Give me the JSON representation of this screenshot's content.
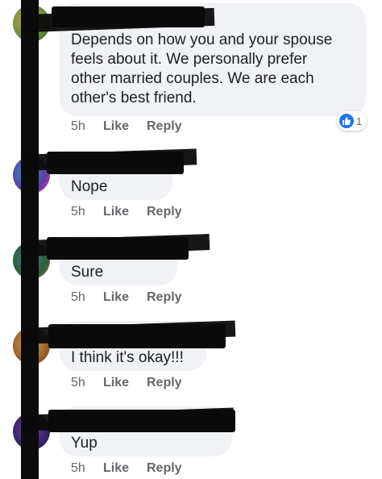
{
  "comments": [
    {
      "text_lines": [
        "Depends on how you and your spouse",
        "feels about it. We personally prefer",
        "other married couples. We are each",
        "other's best friend."
      ],
      "time": "5h",
      "like_label": "Like",
      "reply_label": "Reply",
      "reaction": {
        "icon": "thumbs-up-icon",
        "count": "1",
        "color": "#1877f2"
      }
    },
    {
      "text_lines": [
        "Nope"
      ],
      "time": "5h",
      "like_label": "Like",
      "reply_label": "Reply"
    },
    {
      "text_lines": [
        "Sure"
      ],
      "time": "5h",
      "like_label": "Like",
      "reply_label": "Reply"
    },
    {
      "text_lines": [
        "I think it's okay!!!"
      ],
      "time": "5h",
      "like_label": "Like",
      "reply_label": "Reply"
    },
    {
      "text_lines": [
        "Yup"
      ],
      "time": "5h",
      "like_label": "Like",
      "reply_label": "Reply"
    }
  ],
  "colors": {
    "bubble": "#f0f2f5",
    "action_text": "#65676b",
    "body_text": "#1c1e21",
    "redaction": "#0b0b0b"
  }
}
